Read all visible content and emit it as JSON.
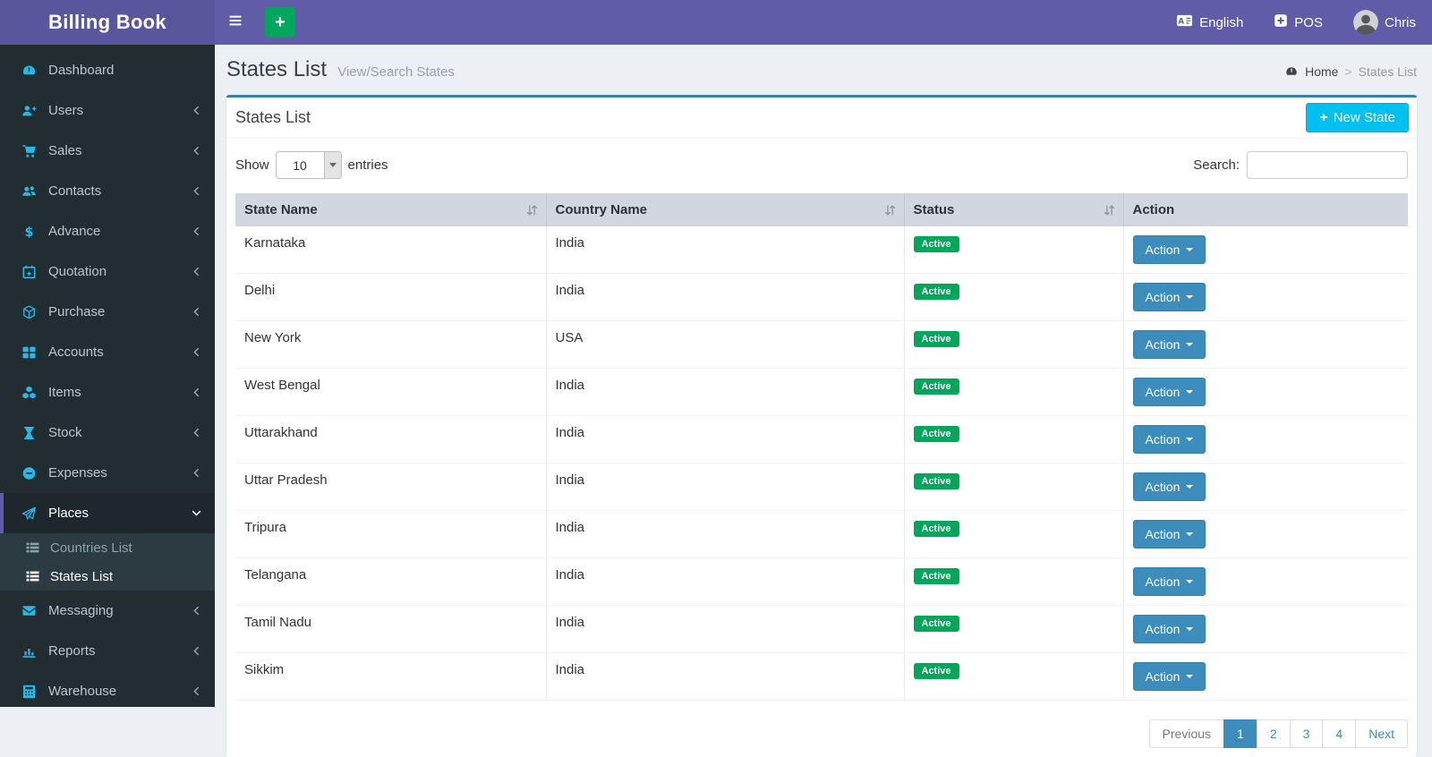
{
  "app": {
    "title": "Billing Book"
  },
  "navbar": {
    "language_label": "English",
    "pos_label": "POS",
    "user_name": "Chris"
  },
  "sidebar": {
    "items": [
      {
        "label": "Dashboard",
        "icon": "dashboard",
        "chevron": "none"
      },
      {
        "label": "Users",
        "icon": "user-plus",
        "chevron": "left"
      },
      {
        "label": "Sales",
        "icon": "cart",
        "chevron": "left"
      },
      {
        "label": "Contacts",
        "icon": "users",
        "chevron": "left"
      },
      {
        "label": "Advance",
        "icon": "dollar",
        "chevron": "left"
      },
      {
        "label": "Quotation",
        "icon": "calendar-plus",
        "chevron": "left"
      },
      {
        "label": "Purchase",
        "icon": "cube",
        "chevron": "left"
      },
      {
        "label": "Accounts",
        "icon": "grid",
        "chevron": "left"
      },
      {
        "label": "Items",
        "icon": "cubes",
        "chevron": "left"
      },
      {
        "label": "Stock",
        "icon": "hourglass",
        "chevron": "left"
      },
      {
        "label": "Expenses",
        "icon": "minus-circle",
        "chevron": "left"
      },
      {
        "label": "Places",
        "icon": "paper-plane",
        "chevron": "down",
        "active": true,
        "children": [
          {
            "label": "Countries List",
            "icon": "list",
            "muted": true
          },
          {
            "label": "States List",
            "icon": "list",
            "active": true
          }
        ]
      },
      {
        "label": "Messaging",
        "icon": "envelope",
        "chevron": "left"
      },
      {
        "label": "Reports",
        "icon": "bar-chart",
        "chevron": "left"
      },
      {
        "label": "Warehouse",
        "icon": "calculator",
        "chevron": "left"
      }
    ]
  },
  "content": {
    "page_title": "States List",
    "page_subtitle": "View/Search States",
    "breadcrumb": {
      "home": "Home",
      "separator": ">",
      "current": "States List"
    },
    "panel": {
      "title": "States List",
      "new_button_label": "New State"
    },
    "controls": {
      "show_label": "Show",
      "page_size": "10",
      "entries_label": "entries",
      "search_label": "Search:",
      "search_value": ""
    },
    "table": {
      "columns": [
        {
          "label": "State Name",
          "sortable": true
        },
        {
          "label": "Country Name",
          "sortable": true
        },
        {
          "label": "Status",
          "sortable": true
        },
        {
          "label": "Action",
          "sortable": false
        }
      ],
      "action_label": "Action",
      "rows": [
        {
          "state": "Karnataka",
          "country": "India",
          "status": "Active"
        },
        {
          "state": "Delhi",
          "country": "India",
          "status": "Active"
        },
        {
          "state": "New York",
          "country": "USA",
          "status": "Active"
        },
        {
          "state": "West Bengal",
          "country": "India",
          "status": "Active"
        },
        {
          "state": "Uttarakhand",
          "country": "India",
          "status": "Active"
        },
        {
          "state": "Uttar Pradesh",
          "country": "India",
          "status": "Active"
        },
        {
          "state": "Tripura",
          "country": "India",
          "status": "Active"
        },
        {
          "state": "Telangana",
          "country": "India",
          "status": "Active"
        },
        {
          "state": "Tamil Nadu",
          "country": "India",
          "status": "Active"
        },
        {
          "state": "Sikkim",
          "country": "India",
          "status": "Active"
        }
      ]
    },
    "pagination": {
      "previous_label": "Previous",
      "pages": [
        "1",
        "2",
        "3",
        "4"
      ],
      "active_page": "1",
      "next_label": "Next"
    }
  },
  "colors": {
    "accent_purple": "#605ca8",
    "sidebar_dark": "#222d32",
    "icon_cyan": "#26b9e8",
    "primary_blue": "#3c8dbc",
    "info_cyan": "#00c0ef",
    "success_green": "#00a65a",
    "content_bg": "#ecf0f5",
    "table_header_bg": "#d2d6de"
  }
}
